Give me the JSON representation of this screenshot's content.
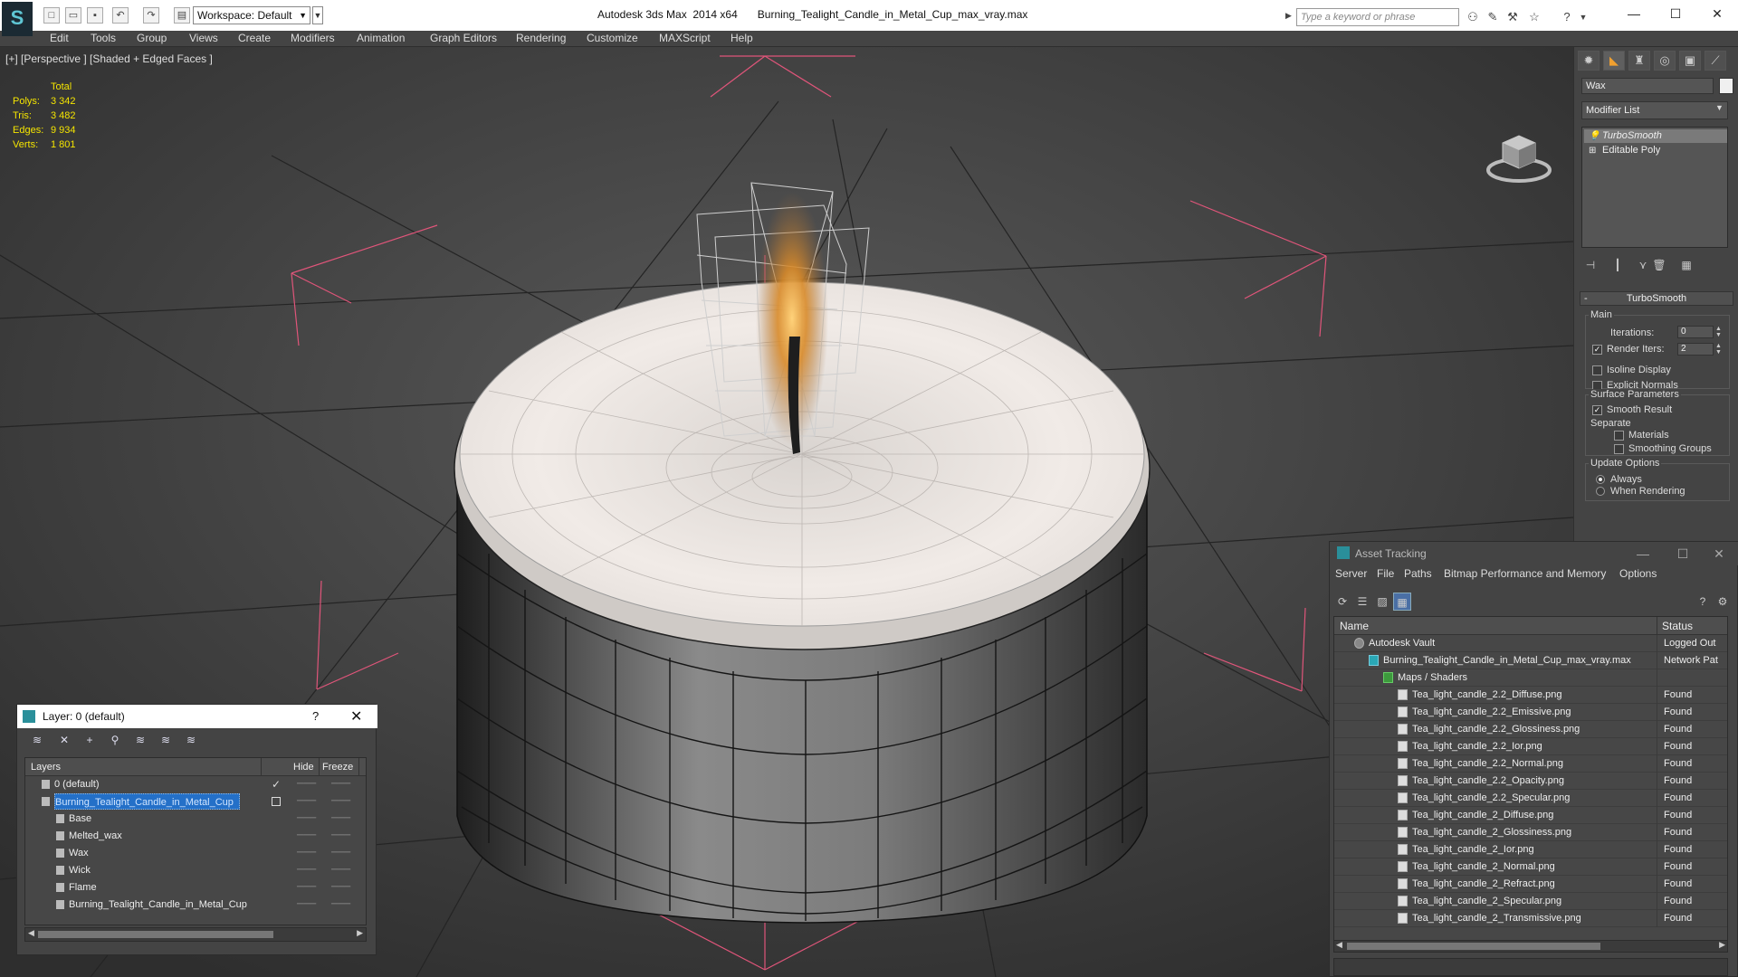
{
  "titlebar": {
    "app_name": "Autodesk 3ds Max  2014 x64",
    "file_name": "Burning_Tealight_Candle_in_Metal_Cup_max_vray.max",
    "workspace": "Workspace: Default",
    "search_placeholder": "Type a keyword or phrase"
  },
  "menu": [
    "Edit",
    "Tools",
    "Group",
    "Views",
    "Create",
    "Modifiers",
    "Animation",
    "Graph Editors",
    "Rendering",
    "Customize",
    "MAXScript",
    "Help"
  ],
  "viewport": {
    "label": "[+] [Perspective ] [Shaded + Edged Faces ]",
    "stats": {
      "header": "Total",
      "rows": [
        {
          "k": "Polys:",
          "v": "3 342"
        },
        {
          "k": "Tris:",
          "v": "3 482"
        },
        {
          "k": "Edges:",
          "v": "9 934"
        },
        {
          "k": "Verts:",
          "v": "1 801"
        }
      ]
    }
  },
  "command_panel": {
    "object_name": "Wax",
    "modifier_list": "Modifier List",
    "stack": [
      "TurboSmooth",
      "Editable Poly"
    ],
    "rollout_title": "TurboSmooth",
    "main_group": "Main",
    "iterations_label": "Iterations:",
    "iterations_value": "0",
    "render_iters_label": "Render Iters:",
    "render_iters_value": "2",
    "isoline_label": "Isoline Display",
    "explicit_normals_label": "Explicit Normals",
    "surface_group": "Surface Parameters",
    "smooth_result_label": "Smooth Result",
    "separate_label": "Separate",
    "materials_label": "Materials",
    "smoothing_groups_label": "Smoothing Groups",
    "update_group": "Update Options",
    "always_label": "Always",
    "when_rendering_label": "When Rendering"
  },
  "asset_tracking": {
    "title": "Asset Tracking",
    "menu": [
      "Server",
      "File",
      "Paths",
      "Bitmap Performance and Memory",
      "Options"
    ],
    "col_name": "Name",
    "col_status": "Status",
    "rows": [
      {
        "name": "Autodesk Vault",
        "status": "Logged Out",
        "indent": 1,
        "icon": "vault"
      },
      {
        "name": "Burning_Tealight_Candle_in_Metal_Cup_max_vray.max",
        "status": "Network Pat",
        "indent": 2,
        "icon": "max"
      },
      {
        "name": "Maps / Shaders",
        "status": "",
        "indent": 3,
        "icon": "folder"
      },
      {
        "name": "Tea_light_candle_2.2_Diffuse.png",
        "status": "Found",
        "indent": 4,
        "icon": "file"
      },
      {
        "name": "Tea_light_candle_2.2_Emissive.png",
        "status": "Found",
        "indent": 4,
        "icon": "file"
      },
      {
        "name": "Tea_light_candle_2.2_Glossiness.png",
        "status": "Found",
        "indent": 4,
        "icon": "file"
      },
      {
        "name": "Tea_light_candle_2.2_Ior.png",
        "status": "Found",
        "indent": 4,
        "icon": "file"
      },
      {
        "name": "Tea_light_candle_2.2_Normal.png",
        "status": "Found",
        "indent": 4,
        "icon": "file"
      },
      {
        "name": "Tea_light_candle_2.2_Opacity.png",
        "status": "Found",
        "indent": 4,
        "icon": "file"
      },
      {
        "name": "Tea_light_candle_2.2_Specular.png",
        "status": "Found",
        "indent": 4,
        "icon": "file"
      },
      {
        "name": "Tea_light_candle_2_Diffuse.png",
        "status": "Found",
        "indent": 4,
        "icon": "file"
      },
      {
        "name": "Tea_light_candle_2_Glossiness.png",
        "status": "Found",
        "indent": 4,
        "icon": "file"
      },
      {
        "name": "Tea_light_candle_2_Ior.png",
        "status": "Found",
        "indent": 4,
        "icon": "file"
      },
      {
        "name": "Tea_light_candle_2_Normal.png",
        "status": "Found",
        "indent": 4,
        "icon": "file"
      },
      {
        "name": "Tea_light_candle_2_Refract.png",
        "status": "Found",
        "indent": 4,
        "icon": "file"
      },
      {
        "name": "Tea_light_candle_2_Specular.png",
        "status": "Found",
        "indent": 4,
        "icon": "file"
      },
      {
        "name": "Tea_light_candle_2_Transmissive.png",
        "status": "Found",
        "indent": 4,
        "icon": "file"
      }
    ]
  },
  "layer_manager": {
    "title": "Layer: 0 (default)",
    "help": "?",
    "col_layers": "Layers",
    "col_hide": "Hide",
    "col_freeze": "Freeze",
    "rows": [
      {
        "name": "0 (default)",
        "indent": 1,
        "current": true
      },
      {
        "name": "Burning_Tealight_Candle_in_Metal_Cup",
        "indent": 1,
        "selected": true
      },
      {
        "name": "Base",
        "indent": 2
      },
      {
        "name": "Melted_wax",
        "indent": 2
      },
      {
        "name": "Wax",
        "indent": 2
      },
      {
        "name": "Wick",
        "indent": 2
      },
      {
        "name": "Flame",
        "indent": 2
      },
      {
        "name": "Burning_Tealight_Candle_in_Metal_Cup",
        "indent": 2
      }
    ]
  },
  "colors": {
    "stats": "#f5e500",
    "selection": "#2470c8",
    "bbox": "#e0557a"
  }
}
